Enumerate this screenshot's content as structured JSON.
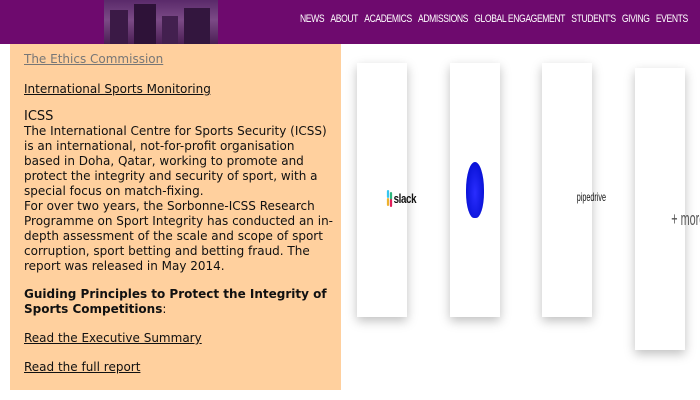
{
  "nav": [
    "NEWS",
    "ABOUT",
    "ACADEMICS",
    "ADMISSIONS",
    "GLOBAL ENGAGEMENT",
    "STUDENT'S",
    "GIVING",
    "EVENTS"
  ],
  "left": {
    "link_ethics": "The Ethics Commission",
    "link_monitoring": "International Sports Monitoring",
    "heading": "ICSS",
    "para1": "The International Centre for Sports Security (ICSS) is an international, not-for-profit organisation based in Doha, Qatar, working to promote and protect the integrity and security of sport, with a special focus on match-fixing.",
    "para2": "For over two years, the Sorbonne-ICSS Research Programme on Sport Integrity has conducted an in-depth assessment of the scale and scope of sport corruption, sport betting and betting fraud. The report was released in May 2014.",
    "guiding_bold": "Guiding Principles to Protect the Integrity of Sports Competitions",
    "guiding_tail": ":",
    "link_exec": "Read the Executive Summary",
    "link_full": "Read the full report"
  },
  "cards": {
    "slack": "slack",
    "pipedrive": "pipedrive",
    "more": "+ more"
  },
  "colors": {
    "topbar": "#6e0a6e",
    "panel": "#ffd09e",
    "blob": "#1a1fe6"
  }
}
